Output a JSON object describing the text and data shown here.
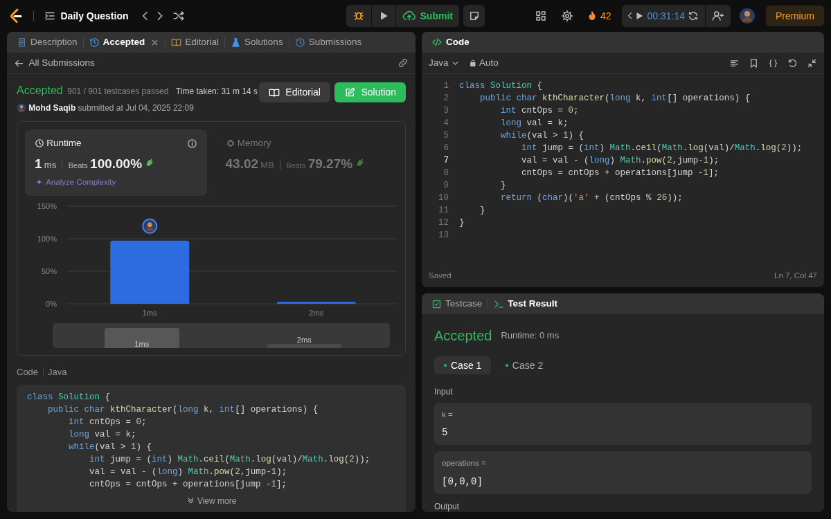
{
  "topbar": {
    "title": "Daily Question",
    "submit": "Submit",
    "streak": "42",
    "timer": "00:31:14",
    "premium": "Premium"
  },
  "left_tabs": [
    {
      "label": "Description",
      "selected": false,
      "closable": false
    },
    {
      "label": "Accepted",
      "selected": true,
      "closable": true
    },
    {
      "label": "Editorial",
      "selected": false,
      "closable": false
    },
    {
      "label": "Solutions",
      "selected": false,
      "closable": false
    },
    {
      "label": "Submissions",
      "selected": false,
      "closable": false
    }
  ],
  "back_link": "All Submissions",
  "result": {
    "status": "Accepted",
    "testcases": "901 / 901 testcases passed",
    "time_taken": "Time taken: 31 m 14 s",
    "author": "Mohd Saqib",
    "submitted": "submitted at Jul 04, 2025 22:09",
    "buttons": [
      "Editorial",
      "Solution"
    ]
  },
  "metrics": [
    {
      "title": "Runtime",
      "value": "1",
      "unit": "ms",
      "beats_label": "Beats",
      "beats": "100.00%",
      "selected": true,
      "action": "Analyze Complexity"
    },
    {
      "title": "Memory",
      "value": "43.02",
      "unit": "MB",
      "beats_label": "Beats",
      "beats": "79.27%",
      "selected": false
    }
  ],
  "chart_data": {
    "type": "bar",
    "categories": [
      "1ms",
      "2ms"
    ],
    "values": [
      97,
      3
    ],
    "ylim": [
      0,
      150
    ],
    "yticks": [
      {
        "value": 0,
        "label": "0%"
      },
      {
        "value": 50,
        "label": "50%"
      },
      {
        "value": 100,
        "label": "100%"
      },
      {
        "value": 150,
        "label": "150%"
      }
    ]
  },
  "navigator": [
    "1ms",
    "2ms"
  ],
  "code_view": {
    "label": "Code",
    "language": "Java",
    "view_more": "View more",
    "lines": [
      {
        "tokens": [
          {
            "kind": "keyword",
            "text": "class"
          },
          {
            "kind": "type",
            "text": " Solution"
          },
          {
            "kind": "plain",
            "text": " {"
          }
        ]
      },
      {
        "tokens": [
          {
            "kind": "keyword",
            "text": "    public"
          },
          {
            "kind": "keyword",
            "text": " char"
          },
          {
            "kind": "function",
            "text": " kthCharacter"
          },
          {
            "kind": "plain",
            "text": "("
          },
          {
            "kind": "keyword",
            "text": "long"
          },
          {
            "kind": "plain",
            "text": " k, "
          },
          {
            "kind": "keyword",
            "text": "int"
          },
          {
            "kind": "plain",
            "text": "[] operations) {"
          }
        ]
      },
      {
        "tokens": [
          {
            "kind": "keyword",
            "text": "        int"
          },
          {
            "kind": "plain",
            "text": " cntOps = "
          },
          {
            "kind": "number",
            "text": "0"
          },
          {
            "kind": "plain",
            "text": ";"
          }
        ]
      },
      {
        "tokens": [
          {
            "kind": "keyword",
            "text": "        long"
          },
          {
            "kind": "plain",
            "text": " val = k;"
          }
        ]
      },
      {
        "tokens": [
          {
            "kind": "keyword",
            "text": "        while"
          },
          {
            "kind": "plain",
            "text": "(val > "
          },
          {
            "kind": "number",
            "text": "1"
          },
          {
            "kind": "plain",
            "text": ") {"
          }
        ]
      },
      {
        "tokens": [
          {
            "kind": "keyword",
            "text": "            int"
          },
          {
            "kind": "plain",
            "text": " jump = ("
          },
          {
            "kind": "keyword",
            "text": "int"
          },
          {
            "kind": "plain",
            "text": ") "
          },
          {
            "kind": "type",
            "text": "Math"
          },
          {
            "kind": "plain",
            "text": "."
          },
          {
            "kind": "function",
            "text": "ceil"
          },
          {
            "kind": "plain",
            "text": "("
          },
          {
            "kind": "type",
            "text": "Math"
          },
          {
            "kind": "plain",
            "text": "."
          },
          {
            "kind": "function",
            "text": "log"
          },
          {
            "kind": "plain",
            "text": "(val)/"
          },
          {
            "kind": "type",
            "text": "Math"
          },
          {
            "kind": "plain",
            "text": "."
          },
          {
            "kind": "function",
            "text": "log"
          },
          {
            "kind": "plain",
            "text": "("
          },
          {
            "kind": "number",
            "text": "2"
          },
          {
            "kind": "plain",
            "text": "));"
          }
        ]
      },
      {
        "tokens": [
          {
            "kind": "plain",
            "text": "            val = val - ("
          },
          {
            "kind": "keyword",
            "text": "long"
          },
          {
            "kind": "plain",
            "text": ") "
          },
          {
            "kind": "type",
            "text": "Math"
          },
          {
            "kind": "plain",
            "text": "."
          },
          {
            "kind": "function",
            "text": "pow"
          },
          {
            "kind": "plain",
            "text": "("
          },
          {
            "kind": "number",
            "text": "2"
          },
          {
            "kind": "plain",
            "text": ",jump-"
          },
          {
            "kind": "number",
            "text": "1"
          },
          {
            "kind": "plain",
            "text": ");"
          }
        ]
      },
      {
        "tokens": [
          {
            "kind": "plain",
            "text": "            cntOps = cntOps + operations[jump -"
          },
          {
            "kind": "number",
            "text": "1"
          },
          {
            "kind": "plain",
            "text": "];"
          }
        ]
      }
    ]
  },
  "editor": {
    "title": "Code",
    "language": "Java",
    "mode": "Auto",
    "status": "Saved",
    "cursor": "Ln 7, Col 47",
    "lines": [
      {
        "num": "1",
        "current": false,
        "tokens": [
          {
            "kind": "keyword",
            "text": "class"
          },
          {
            "kind": "type",
            "text": " Solution"
          },
          {
            "kind": "plain",
            "text": " {"
          }
        ]
      },
      {
        "num": "2",
        "current": false,
        "tokens": [
          {
            "kind": "keyword",
            "text": "    public"
          },
          {
            "kind": "keyword",
            "text": " char"
          },
          {
            "kind": "function",
            "text": " kthCharacter"
          },
          {
            "kind": "plain",
            "text": "("
          },
          {
            "kind": "keyword",
            "text": "long"
          },
          {
            "kind": "plain",
            "text": " k, "
          },
          {
            "kind": "keyword",
            "text": "int"
          },
          {
            "kind": "plain",
            "text": "[] operations) {"
          }
        ]
      },
      {
        "num": "3",
        "current": false,
        "tokens": [
          {
            "kind": "keyword",
            "text": "        int"
          },
          {
            "kind": "plain",
            "text": " cntOps = "
          },
          {
            "kind": "number",
            "text": "0"
          },
          {
            "kind": "plain",
            "text": ";"
          }
        ]
      },
      {
        "num": "4",
        "current": false,
        "tokens": [
          {
            "kind": "keyword",
            "text": "        long"
          },
          {
            "kind": "plain",
            "text": " val = k;"
          }
        ]
      },
      {
        "num": "5",
        "current": false,
        "tokens": [
          {
            "kind": "keyword",
            "text": "        while"
          },
          {
            "kind": "plain",
            "text": "(val > "
          },
          {
            "kind": "number",
            "text": "1"
          },
          {
            "kind": "plain",
            "text": ") {"
          }
        ]
      },
      {
        "num": "6",
        "current": false,
        "tokens": [
          {
            "kind": "keyword",
            "text": "            int"
          },
          {
            "kind": "plain",
            "text": " jump = ("
          },
          {
            "kind": "keyword",
            "text": "int"
          },
          {
            "kind": "plain",
            "text": ") "
          },
          {
            "kind": "type",
            "text": "Math"
          },
          {
            "kind": "plain",
            "text": "."
          },
          {
            "kind": "function",
            "text": "ceil"
          },
          {
            "kind": "plain",
            "text": "("
          },
          {
            "kind": "type",
            "text": "Math"
          },
          {
            "kind": "plain",
            "text": "."
          },
          {
            "kind": "function",
            "text": "log"
          },
          {
            "kind": "plain",
            "text": "(val)/"
          },
          {
            "kind": "type",
            "text": "Math"
          },
          {
            "kind": "plain",
            "text": "."
          },
          {
            "kind": "function",
            "text": "log"
          },
          {
            "kind": "plain",
            "text": "("
          },
          {
            "kind": "number",
            "text": "2"
          },
          {
            "kind": "plain",
            "text": "));"
          }
        ]
      },
      {
        "num": "7",
        "current": true,
        "tokens": [
          {
            "kind": "plain",
            "text": "            val = val - ("
          },
          {
            "kind": "keyword",
            "text": "long"
          },
          {
            "kind": "plain",
            "text": ") "
          },
          {
            "kind": "type",
            "text": "Math"
          },
          {
            "kind": "plain",
            "text": "."
          },
          {
            "kind": "function",
            "text": "pow"
          },
          {
            "kind": "plain",
            "text": "("
          },
          {
            "kind": "number",
            "text": "2"
          },
          {
            "kind": "plain",
            "text": ",jump-"
          },
          {
            "kind": "number",
            "text": "1"
          },
          {
            "kind": "plain",
            "text": ");"
          }
        ]
      },
      {
        "num": "8",
        "current": false,
        "tokens": [
          {
            "kind": "plain",
            "text": "            cntOps = cntOps + operations[jump -"
          },
          {
            "kind": "number",
            "text": "1"
          },
          {
            "kind": "plain",
            "text": "];"
          }
        ]
      },
      {
        "num": "9",
        "current": false,
        "tokens": [
          {
            "kind": "plain",
            "text": "        }"
          }
        ]
      },
      {
        "num": "10",
        "current": false,
        "tokens": [
          {
            "kind": "keyword",
            "text": "        return"
          },
          {
            "kind": "plain",
            "text": " ("
          },
          {
            "kind": "keyword",
            "text": "char"
          },
          {
            "kind": "plain",
            "text": ")("
          },
          {
            "kind": "string",
            "text": "'a'"
          },
          {
            "kind": "plain",
            "text": " + (cntOps % "
          },
          {
            "kind": "number",
            "text": "26"
          },
          {
            "kind": "plain",
            "text": "));"
          }
        ]
      },
      {
        "num": "11",
        "current": false,
        "tokens": [
          {
            "kind": "plain",
            "text": "    }"
          }
        ]
      },
      {
        "num": "12",
        "current": false,
        "tokens": [
          {
            "kind": "plain",
            "text": "}"
          }
        ]
      },
      {
        "num": "13",
        "current": false
      }
    ]
  },
  "test_panel": {
    "tabs": [
      {
        "label": "Testcase",
        "selected": false
      },
      {
        "label": "Test Result",
        "selected": true
      }
    ],
    "status": "Accepted",
    "runtime": "Runtime: 0 ms",
    "cases": [
      {
        "label": "Case 1",
        "selected": true
      },
      {
        "label": "Case 2",
        "selected": false
      }
    ],
    "input_label": "Input",
    "inputs": [
      {
        "name": "k =",
        "value": "5"
      },
      {
        "name": "operations =",
        "value": "[0,0,0]"
      }
    ],
    "output_label": "Output"
  }
}
